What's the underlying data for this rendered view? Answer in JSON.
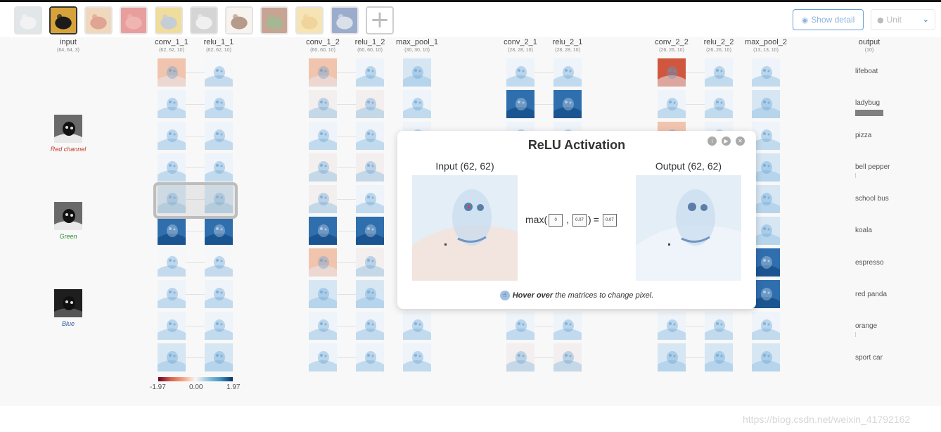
{
  "toolbar": {
    "thumbnails": [
      {
        "name": "thumb-1",
        "color": "#c9d3d8",
        "accent": "#e9e9e9"
      },
      {
        "name": "thumb-ladybug",
        "color": "#d6a23a",
        "accent": "#1b1b1b"
      },
      {
        "name": "thumb-pizza",
        "color": "#e4b98a",
        "accent": "#c75a3a"
      },
      {
        "name": "thumb-bell-pepper",
        "color": "#d8504f",
        "accent": "#e37a73"
      },
      {
        "name": "thumb-school-bus",
        "color": "#e6c24a",
        "accent": "#97a7b5"
      },
      {
        "name": "thumb-koala",
        "color": "#b3b3b3",
        "accent": "#e4e4e4"
      },
      {
        "name": "thumb-espresso",
        "color": "#f1ece4",
        "accent": "#7b4a2c"
      },
      {
        "name": "thumb-red-panda",
        "color": "#9a5a3b",
        "accent": "#5e7d3e"
      },
      {
        "name": "thumb-orange",
        "color": "#f0ce78",
        "accent": "#e7b14c"
      },
      {
        "name": "thumb-sport-car",
        "color": "#4a6aa6",
        "accent": "#bdc8d6"
      }
    ],
    "add_label": "+",
    "show_detail_label": "Show detail",
    "unit_label": "Unit"
  },
  "layers": [
    {
      "name": "input",
      "shape": "(64, 64, 3)"
    },
    {
      "name": "conv_1_1",
      "shape": "(62, 62, 10)"
    },
    {
      "name": "relu_1_1",
      "shape": "(62, 62, 10)"
    },
    {
      "name": "conv_1_2",
      "shape": "(60, 60, 10)"
    },
    {
      "name": "relu_1_2",
      "shape": "(60, 60, 10)"
    },
    {
      "name": "max_pool_1",
      "shape": "(30, 30, 10)"
    },
    {
      "name": "conv_2_1",
      "shape": "(28, 28, 10)"
    },
    {
      "name": "relu_2_1",
      "shape": "(28, 28, 10)"
    },
    {
      "name": "conv_2_2",
      "shape": "(26, 26, 10)"
    },
    {
      "name": "relu_2_2",
      "shape": "(26, 26, 10)"
    },
    {
      "name": "max_pool_2",
      "shape": "(13, 13, 10)"
    },
    {
      "name": "output",
      "shape": "(10)"
    }
  ],
  "input_channels": [
    {
      "label": "Red channel",
      "color": "#c0392b"
    },
    {
      "label": "Green",
      "color": "#2e8b2e"
    },
    {
      "label": "Blue",
      "color": "#2c5aa0"
    }
  ],
  "outputs": [
    {
      "label": "lifeboat",
      "prob": 0.0
    },
    {
      "label": "ladybug",
      "prob": 1.0
    },
    {
      "label": "pizza",
      "prob": 0.0
    },
    {
      "label": "bell pepper",
      "prob": 0.02
    },
    {
      "label": "school bus",
      "prob": 0.0
    },
    {
      "label": "koala",
      "prob": 0.0
    },
    {
      "label": "espresso",
      "prob": 0.0
    },
    {
      "label": "red panda",
      "prob": 0.0
    },
    {
      "label": "orange",
      "prob": 0.02
    },
    {
      "label": "sport car",
      "prob": 0.0
    }
  ],
  "colorbar": {
    "min": "-1.97",
    "mid": "0.00",
    "max": "1.97"
  },
  "modal": {
    "title": "ReLU Activation",
    "input_caption": "Input (62, 62)",
    "output_caption": "Output (62, 62)",
    "formula_prefix": "max(",
    "formula_a": "0",
    "formula_sep": ",",
    "formula_b": "0.07",
    "formula_close": ")",
    "formula_eq": "=",
    "formula_result": "0.07",
    "hint_bold": "Hover over",
    "hint_rest": " the matrices to change pixel."
  },
  "watermark": "https://blog.csdn.net/weixin_41792162"
}
